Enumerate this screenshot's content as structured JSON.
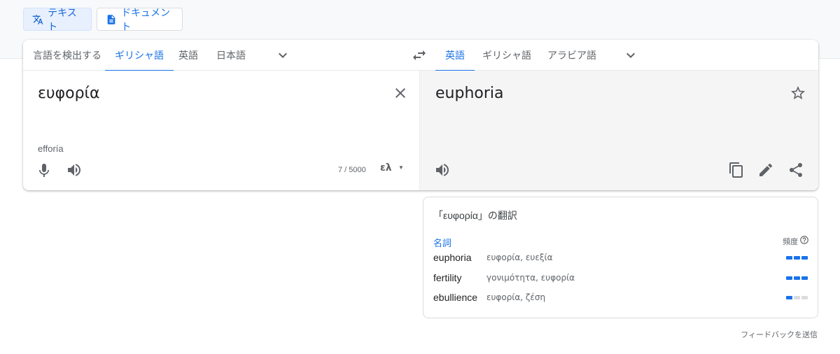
{
  "modes": {
    "text_label": "テキスト",
    "doc_label": "ドキュメント"
  },
  "source_langs": [
    "言語を検出する",
    "ギリシャ語",
    "英語",
    "日本語"
  ],
  "target_langs": [
    "英語",
    "ギリシャ語",
    "アラビア語"
  ],
  "source": {
    "text": "ευφορία",
    "transliteration": "efforía",
    "counter": "7 / 5000",
    "keyboard": "ελ"
  },
  "target": {
    "text": "euphoria"
  },
  "dictionary": {
    "title": "「ευφορία」の翻訳",
    "part_of_speech": "名詞",
    "frequency_label": "頻度",
    "entries": [
      {
        "word": "euphoria",
        "synonyms": "ευφορία, ευεξία",
        "frequency": 3
      },
      {
        "word": "fertility",
        "synonyms": "γονιμότητα, ευφορία",
        "frequency": 3
      },
      {
        "word": "ebullience",
        "synonyms": "ευφορία, ζέση",
        "frequency": 1
      }
    ]
  },
  "feedback": "フィードバックを送信",
  "colors": {
    "accent": "#1a73e8",
    "target_bg": "#f5f5f5",
    "top_band": "#f8f9fa"
  }
}
